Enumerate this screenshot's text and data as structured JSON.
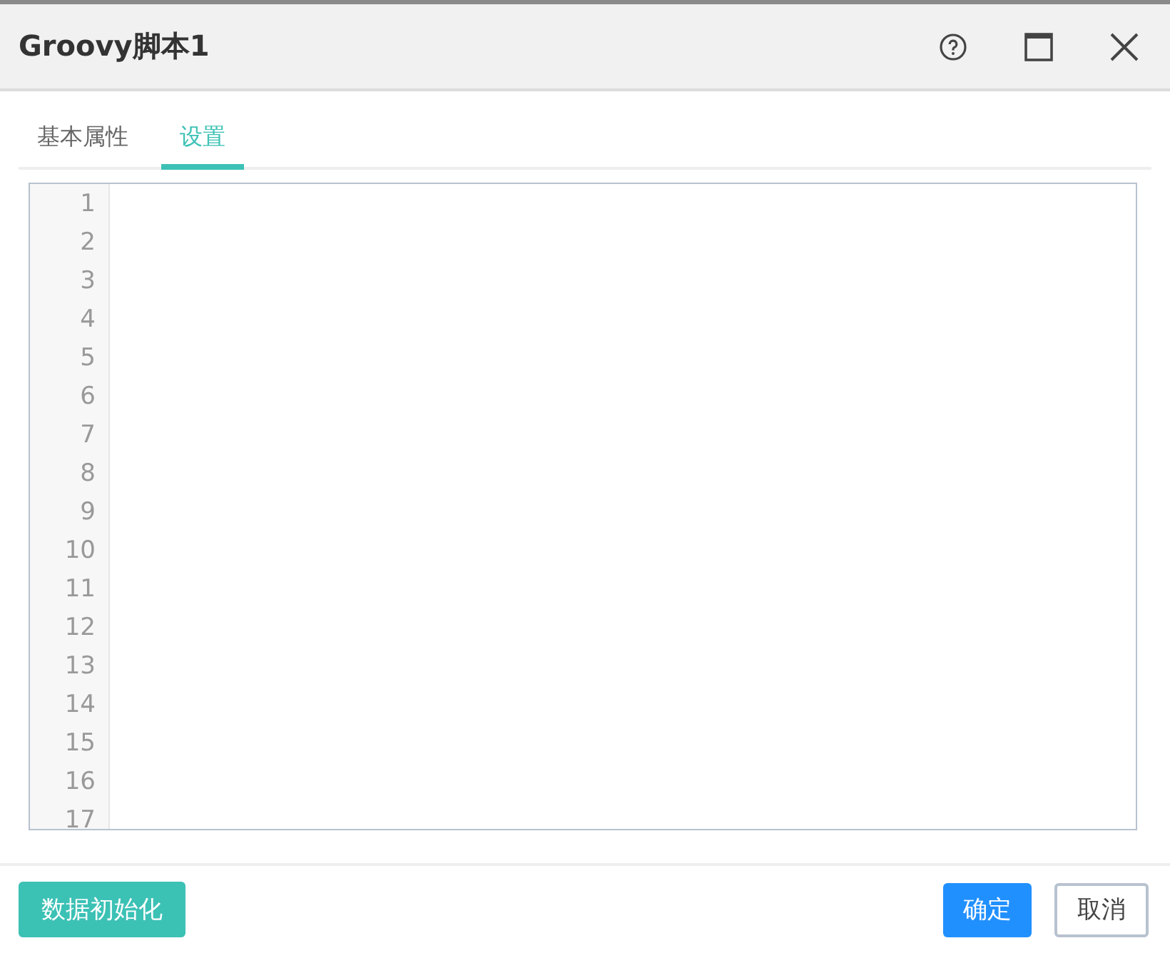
{
  "window": {
    "title": "Groovy脚本1"
  },
  "tabs": [
    {
      "label": "基本属性",
      "selected": false
    },
    {
      "label": "设置",
      "selected": true
    }
  ],
  "editor": {
    "line_numbers": [
      "1",
      "2",
      "3",
      "4",
      "5",
      "6",
      "7",
      "8",
      "9",
      "10",
      "11",
      "12",
      "13",
      "14",
      "15",
      "16",
      "17"
    ]
  },
  "footer": {
    "left_button": "数据初始化",
    "buttons": [
      {
        "label": "确定",
        "kind": "primary"
      },
      {
        "label": "取消",
        "kind": "default"
      }
    ]
  }
}
